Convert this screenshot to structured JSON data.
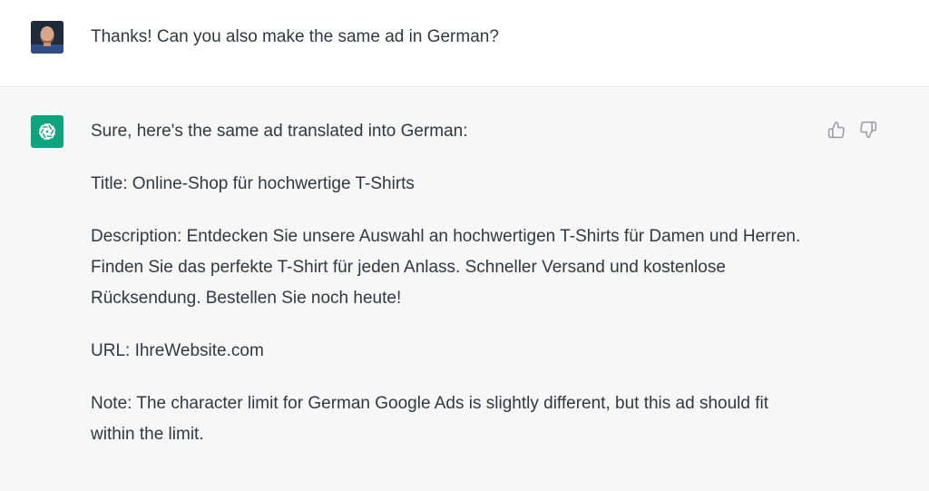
{
  "user_message": {
    "text": "Thanks! Can you also make the same ad in German?"
  },
  "assistant_message": {
    "paragraphs": [
      "Sure, here's the same ad translated into German:",
      "Title: Online-Shop für hochwertige T-Shirts",
      "Description: Entdecken Sie unsere Auswahl an hochwertigen T-Shirts für Damen und Herren. Finden Sie das perfekte T-Shirt für jeden Anlass. Schneller Versand und kostenlose Rücksendung. Bestellen Sie noch heute!",
      "URL: IhreWebsite.com",
      "Note: The character limit for German Google Ads is slightly different, but this ad should fit within the limit."
    ]
  },
  "icons": {
    "user_avatar": "user-avatar",
    "assistant_logo": "openai-logo-icon",
    "like": "thumbs-up-icon",
    "dislike": "thumbs-down-icon"
  },
  "colors": {
    "assistant_bg": "#f7f7f8",
    "logo_bg": "#10a37f",
    "text": "#353740"
  }
}
